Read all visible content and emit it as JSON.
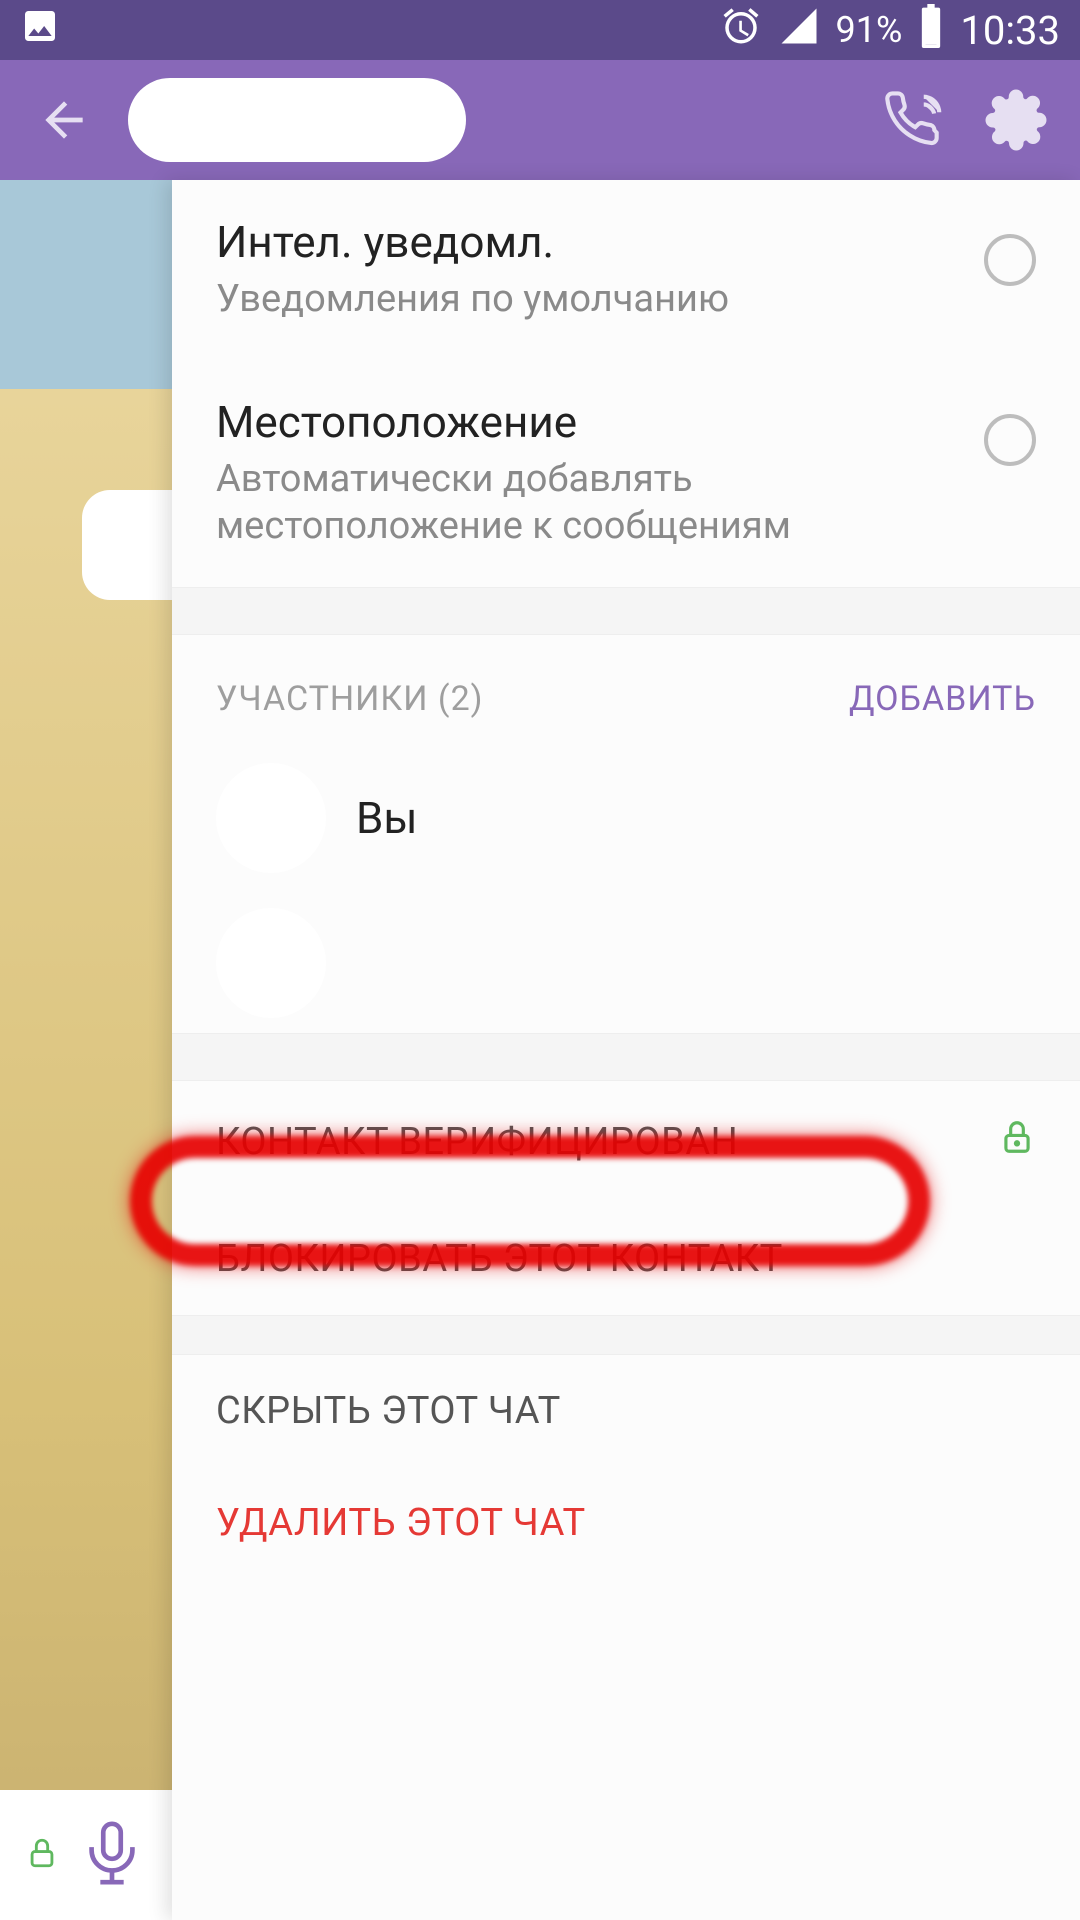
{
  "status": {
    "battery_pct": "91%",
    "time": "10:33"
  },
  "appbar": {
    "title_hidden": true
  },
  "settings": {
    "notifications": {
      "title": "Интел. уведомл.",
      "subtitle": "Уведомления по умолчанию"
    },
    "location": {
      "title": "Местоположение",
      "subtitle": "Автоматически добавлять местоположение к сообщениям"
    },
    "participants": {
      "header": "УЧАСТНИКИ (2)",
      "add": "ДОБАВИТЬ",
      "you": "Вы"
    },
    "actions": {
      "verified": "КОНТАКТ ВЕРИФИЦИРОВАН",
      "block": "БЛОКИРОВАТЬ ЭТОТ КОНТАКТ",
      "hide": "СКРЫТЬ ЭТОТ ЧАТ",
      "delete": "УДАЛИТЬ ЭТОТ ЧАТ"
    }
  }
}
